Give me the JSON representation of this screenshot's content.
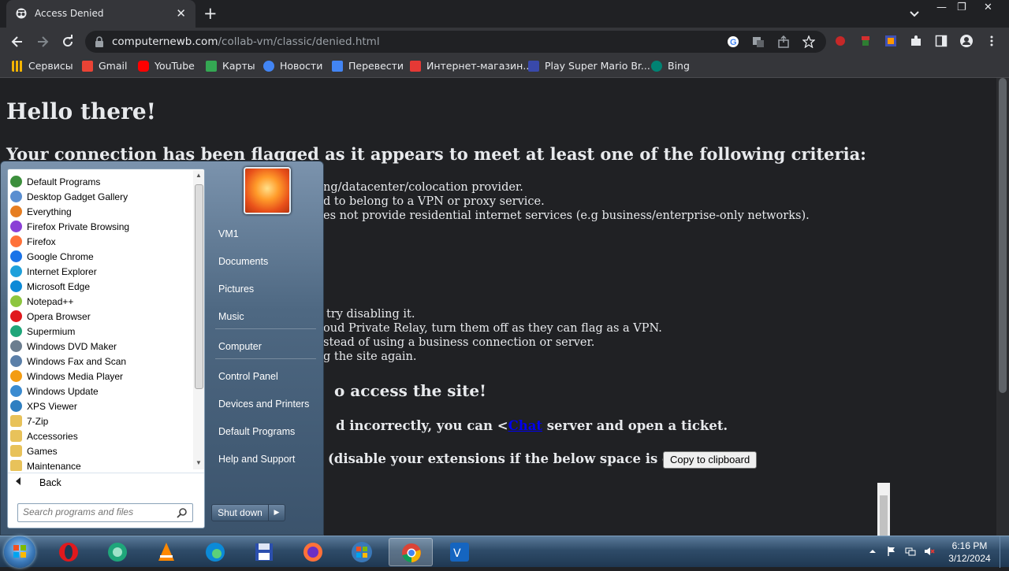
{
  "browser": {
    "tab_title": "Access Denied",
    "url_host": "computernewb.com",
    "url_path": "/collab-vm/classic/denied.html",
    "bookmarks": [
      "Сервисы",
      "Gmail",
      "YouTube",
      "Карты",
      "Новости",
      "Перевести",
      "Интернет-магазин...",
      "Play Super Mario Br...",
      "Bing"
    ]
  },
  "page": {
    "heading": "Hello there!",
    "subheading": "Your connection has been flagged as it appears to meet at least one of the following criteria:",
    "criteria_lines": [
      "ng/datacenter/colocation provider.",
      "d to belong to a VPN or proxy service.",
      "es not provide residential internet services (e.g business/enterprise-only networks)."
    ],
    "fix_lines": [
      "try disabling it.",
      "oud Private Relay, turn them off as they can flag as a VPN.",
      "stead of using a business connection or server.",
      "g the site again."
    ],
    "access_heading": "o access the site!",
    "ticket_pre": "d incorrectly, you can <",
    "ticket_link": "Chat",
    "ticket_post": " server and open a ticket.",
    "clipboard_label": "(disable your extensions if the below space is empty):",
    "copy_button": "Copy to clipboard"
  },
  "start_menu": {
    "programs": [
      {
        "label": "Default Programs",
        "icon": "default-programs-icon",
        "color": "#3c8f3c"
      },
      {
        "label": "Desktop Gadget Gallery",
        "icon": "gadget-icon",
        "color": "#5a8ed0"
      },
      {
        "label": "Everything",
        "icon": "everything-icon",
        "color": "#e67e22"
      },
      {
        "label": "Firefox Private Browsing",
        "icon": "firefox-private-icon",
        "color": "#8b3fd6"
      },
      {
        "label": "Firefox",
        "icon": "firefox-icon",
        "color": "#ff7139"
      },
      {
        "label": "Google Chrome",
        "icon": "chrome-icon",
        "color": "#1a73e8"
      },
      {
        "label": "Internet Explorer",
        "icon": "ie-icon",
        "color": "#1ea0db"
      },
      {
        "label": "Microsoft Edge",
        "icon": "edge-icon",
        "color": "#0c8ad7"
      },
      {
        "label": "Notepad++",
        "icon": "notepadpp-icon",
        "color": "#8dc63f"
      },
      {
        "label": "Opera Browser",
        "icon": "opera-icon",
        "color": "#e0191d"
      },
      {
        "label": "Supermium",
        "icon": "supermium-icon",
        "color": "#1fa67a"
      },
      {
        "label": "Windows DVD Maker",
        "icon": "dvd-maker-icon",
        "color": "#6b7d8f"
      },
      {
        "label": "Windows Fax and Scan",
        "icon": "fax-scan-icon",
        "color": "#5b7fa8"
      },
      {
        "label": "Windows Media Player",
        "icon": "media-player-icon",
        "color": "#f39c12"
      },
      {
        "label": "Windows Update",
        "icon": "windows-update-icon",
        "color": "#3b8bd0"
      },
      {
        "label": "XPS Viewer",
        "icon": "xps-viewer-icon",
        "color": "#2f7fc1"
      },
      {
        "label": "7-Zip",
        "icon": "folder-icon",
        "color": "#e8c25a"
      },
      {
        "label": "Accessories",
        "icon": "folder-icon",
        "color": "#e8c25a"
      },
      {
        "label": "Games",
        "icon": "folder-icon",
        "color": "#e8c25a"
      },
      {
        "label": "Maintenance",
        "icon": "folder-icon",
        "color": "#e8c25a"
      }
    ],
    "back_label": "Back",
    "search_placeholder": "Search programs and files",
    "right_links": [
      "VM1",
      "Documents",
      "Pictures",
      "Music",
      "Computer",
      "Control Panel",
      "Devices and Printers",
      "Default Programs",
      "Help and Support"
    ],
    "shutdown_label": "Shut down"
  },
  "taskbar": {
    "apps": [
      "opera-icon",
      "supermium-icon",
      "vlc-icon",
      "edge-icon",
      "save-icon",
      "firefox-icon",
      "windows-flag-icon",
      "chrome-icon",
      "vnc-icon"
    ],
    "active_app": "chrome-icon",
    "time": "6:16 PM",
    "date": "3/12/2024"
  }
}
